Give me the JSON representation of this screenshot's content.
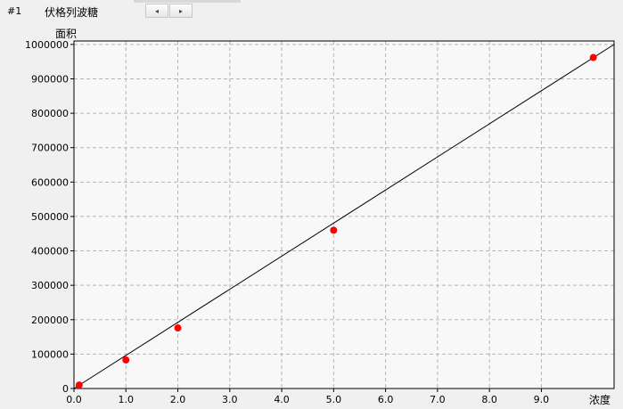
{
  "header": {
    "index": "#1",
    "title": "伏格列波糖",
    "prev_icon": "◂",
    "next_icon": "▸"
  },
  "chart_data": {
    "type": "scatter",
    "ylabel": "面积",
    "xlabel": "浓度",
    "xlim": [
      0,
      10.4
    ],
    "ylim": [
      0,
      1010000
    ],
    "x_ticks": [
      0.0,
      1.0,
      2.0,
      3.0,
      4.0,
      5.0,
      6.0,
      7.0,
      8.0,
      9.0
    ],
    "x_tick_labels": [
      "0.0",
      "1.0",
      "2.0",
      "3.0",
      "4.0",
      "5.0",
      "6.0",
      "7.0",
      "8.0",
      "9.0"
    ],
    "y_ticks": [
      0,
      100000,
      200000,
      300000,
      400000,
      500000,
      600000,
      700000,
      800000,
      900000,
      1000000
    ],
    "y_tick_labels": [
      "0",
      "100000",
      "200000",
      "300000",
      "400000",
      "500000",
      "600000",
      "700000",
      "800000",
      "900000",
      "1000000"
    ],
    "grid": true,
    "points": {
      "x": [
        0.1,
        1.0,
        2.0,
        5.0,
        10.0
      ],
      "y": [
        10000,
        83000,
        176000,
        460000,
        962000
      ]
    },
    "fit_line": {
      "x": [
        0.0,
        10.4
      ],
      "y": [
        0,
        1000000
      ]
    },
    "colors": {
      "point": "#ff0000",
      "line": "#000000",
      "grid": "#b4b4b4",
      "plot_background": "#f8f8f8"
    }
  }
}
